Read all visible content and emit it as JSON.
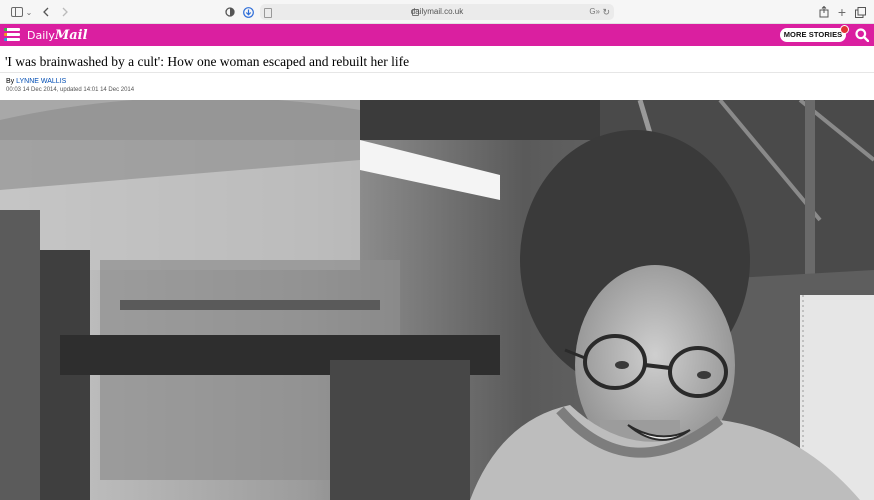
{
  "browser": {
    "url": "dailymail.co.uk",
    "translate_label": "G»"
  },
  "site": {
    "logo_daily": "Daily",
    "logo_mail": "Mail",
    "more_stories": "MORE STORIES",
    "brand_color": "#da1fa0"
  },
  "article": {
    "headline": "'I was brainwashed by a cult': How one woman escaped and rebuilt her life",
    "byline_prefix": "By ",
    "author": "LYNNE WALLIS",
    "dates": "00:03 14 Dec 2014, updated 14:01 14 Dec 2014",
    "photo_icon": "black-and-white-photo-of-smiling-woman-with-glasses"
  }
}
